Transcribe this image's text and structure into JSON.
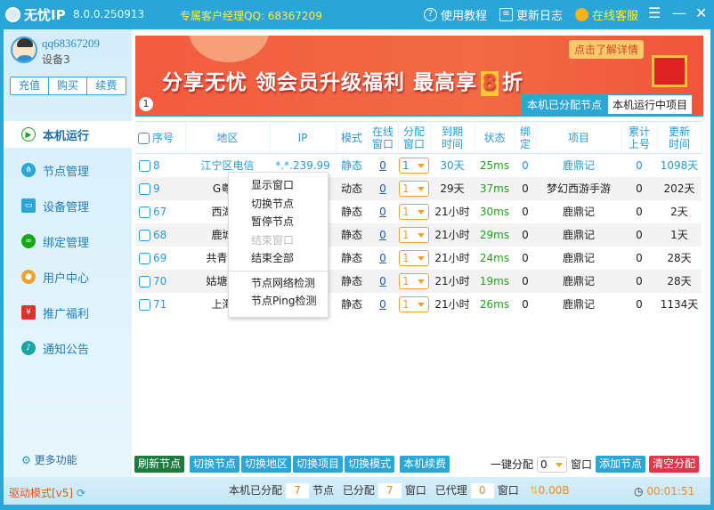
{
  "title": {
    "app": "无忧IP",
    "version": "8.0.0.250913",
    "manager": "专属客户经理QQ: 68367209",
    "links": [
      "使用教程",
      "更新日志",
      "在线客服"
    ]
  },
  "user": {
    "name": "qq68367209",
    "device": "设备3",
    "actions": [
      "充值",
      "购买",
      "续费"
    ]
  },
  "sidebar": {
    "items": [
      {
        "label": "本机运行",
        "icon": "play-icon"
      },
      {
        "label": "节点管理",
        "icon": "network-icon"
      },
      {
        "label": "设备管理",
        "icon": "laptop-icon"
      },
      {
        "label": "绑定管理",
        "icon": "link-icon"
      },
      {
        "label": "用户中心",
        "icon": "user-icon"
      },
      {
        "label": "推广福利",
        "icon": "gift-icon"
      },
      {
        "label": "通知公告",
        "icon": "bell-icon"
      }
    ],
    "more": "更多功能"
  },
  "banner": {
    "slogan_a": "分享无忧 领会员升级福利 最高享",
    "eight": "8",
    "slogan_b": "折",
    "detail": "点击了解详情",
    "page": "1"
  },
  "tabs": [
    "本机已分配节点",
    "本机运行中项目"
  ],
  "table": {
    "headers": [
      "序号",
      "地区",
      "IP",
      "模式",
      "在线窗口",
      "分配窗口",
      "到期时间",
      "状态",
      "绑定",
      "项目",
      "累计上号",
      "更新时间"
    ],
    "rows": [
      [
        "8",
        "江宁区电信",
        "*.*.239.99",
        "静态",
        "0",
        "1",
        "30天",
        "25ms",
        "0",
        "鹿鼎记",
        "0",
        "1098天"
      ],
      [
        "9",
        "G粤港",
        "",
        "动态",
        "0",
        "1",
        "29天",
        "37ms",
        "0",
        "梦幻西游手游",
        "0",
        "202天"
      ],
      [
        "67",
        "西湖电",
        "",
        "静态",
        "0",
        "1",
        "21小时",
        "30ms",
        "0",
        "鹿鼎记",
        "0",
        "2天"
      ],
      [
        "68",
        "鹿城电",
        "",
        "静态",
        "0",
        "1",
        "21小时",
        "29ms",
        "0",
        "鹿鼎记",
        "0",
        "1天"
      ],
      [
        "69",
        "共青城电",
        "",
        "静态",
        "0",
        "1",
        "21小时",
        "24ms",
        "0",
        "鹿鼎记",
        "0",
        "28天"
      ],
      [
        "70",
        "姑塘电信",
        "",
        "静态",
        "0",
        "1",
        "21小时",
        "19ms",
        "0",
        "鹿鼎记",
        "0",
        "28天"
      ],
      [
        "71",
        "上海市",
        "",
        "静态",
        "0",
        "1",
        "21小时",
        "26ms",
        "0",
        "鹿鼎记",
        "0",
        "1134天"
      ]
    ]
  },
  "context_menu": [
    "显示窗口",
    "切换节点",
    "暂停节点",
    "结束窗口",
    "结束全部",
    "节点网络检测",
    "节点Ping检测"
  ],
  "toolbar": {
    "refresh": "刷新节点",
    "switch": [
      "切换节点",
      "切换地区",
      "切换项目",
      "切换模式"
    ],
    "renew": "本机续费",
    "one_key": "一键分配",
    "one_key_value": "0",
    "window": "窗口",
    "add": "添加节点",
    "clear": "清空分配"
  },
  "status": {
    "mode": "驱动模式[v5]",
    "assigned_label": "本机已分配",
    "assigned": "7",
    "node": "节点",
    "allocated_label": "已分配",
    "allocated": "7",
    "window": "窗口",
    "proxy_label": "已代理",
    "proxy": "0",
    "window2": "窗口",
    "traffic": "0.00B",
    "time": "00:01:51"
  }
}
